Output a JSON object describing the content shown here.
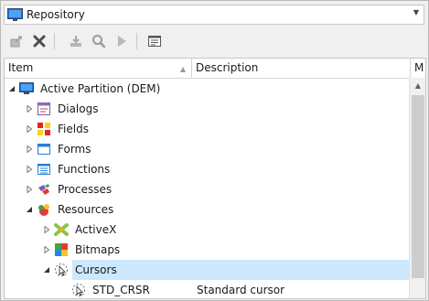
{
  "repository": {
    "label": "Repository"
  },
  "toolbar": {
    "buttons": [
      "export-icon",
      "delete-icon",
      "import-icon",
      "search-icon",
      "run-icon",
      "properties-icon"
    ]
  },
  "columns": {
    "item": "Item",
    "description": "Description",
    "m": "M"
  },
  "tree": [
    {
      "label": "Active Partition (DEM)",
      "description": "",
      "icon": "monitor-icon",
      "state": "expanded"
    },
    {
      "label": "Dialogs",
      "description": "",
      "icon": "dialog-icon",
      "state": "collapsed"
    },
    {
      "label": "Fields",
      "description": "",
      "icon": "fields-icon",
      "state": "collapsed"
    },
    {
      "label": "Forms",
      "description": "",
      "icon": "form-icon",
      "state": "collapsed"
    },
    {
      "label": "Functions",
      "description": "",
      "icon": "function-icon",
      "state": "collapsed"
    },
    {
      "label": "Processes",
      "description": "",
      "icon": "process-icon",
      "state": "collapsed"
    },
    {
      "label": "Resources",
      "description": "",
      "icon": "resources-icon",
      "state": "expanded"
    },
    {
      "label": "ActiveX",
      "description": "",
      "icon": "activex-icon",
      "state": "collapsed"
    },
    {
      "label": "Bitmaps",
      "description": "",
      "icon": "bitmap-icon",
      "state": "collapsed"
    },
    {
      "label": "Cursors",
      "description": "",
      "icon": "cursor-icon",
      "state": "expanded",
      "selected": true
    },
    {
      "label": "STD_CRSR",
      "description": "Standard cursor",
      "icon": "cursor-icon",
      "state": "leaf"
    }
  ],
  "colors": {
    "selection": "#cce8ff",
    "accent_blue": "#1e6fd9"
  }
}
